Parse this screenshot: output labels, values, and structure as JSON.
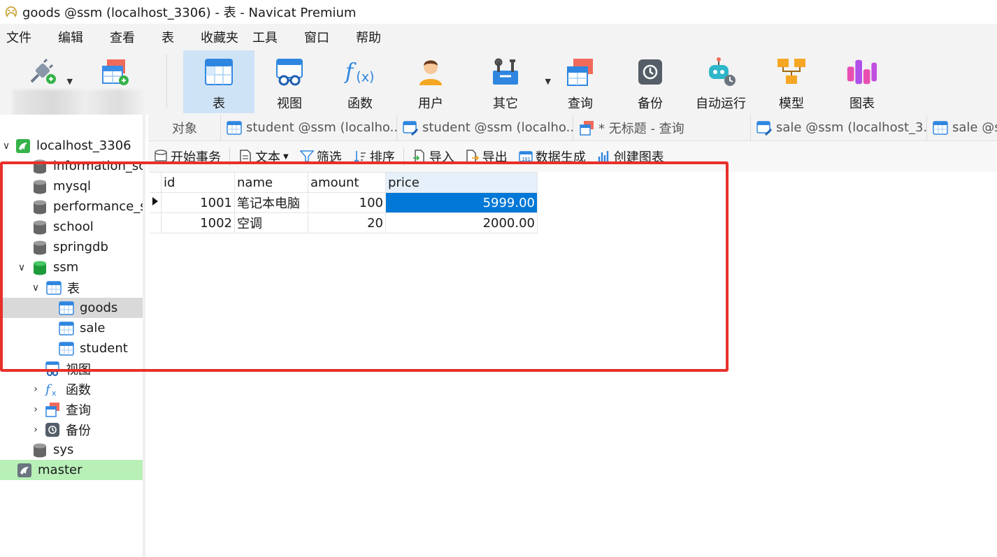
{
  "window": {
    "title": "goods @ssm (localhost_3306) - 表 - Navicat Premium"
  },
  "menu": [
    "文件",
    "编辑",
    "查看",
    "表",
    "收藏夹",
    "工具",
    "窗口",
    "帮助"
  ],
  "toolbar": {
    "items": [
      {
        "label": "表",
        "icon": "table-icon",
        "active": true
      },
      {
        "label": "视图",
        "icon": "view-icon"
      },
      {
        "label": "函数",
        "icon": "function-icon"
      },
      {
        "label": "用户",
        "icon": "user-icon"
      },
      {
        "label": "其它",
        "icon": "tools-icon",
        "has_dropdown": true
      },
      {
        "label": "查询",
        "icon": "query-icon"
      },
      {
        "label": "备份",
        "icon": "backup-icon"
      },
      {
        "label": "自动运行",
        "icon": "robot-icon"
      },
      {
        "label": "模型",
        "icon": "model-icon"
      },
      {
        "label": "图表",
        "icon": "chart-icon"
      }
    ]
  },
  "sidebar": {
    "connection": "localhost_3306",
    "databases": [
      "information_sch",
      "mysql",
      "performance_sc",
      "school",
      "springdb",
      "ssm"
    ],
    "ssm_children": {
      "tables_label": "表",
      "tables": [
        "goods",
        "sale",
        "student"
      ],
      "views_label": "视图",
      "functions_label": "函数",
      "queries_label": "查询",
      "backups_label": "备份"
    },
    "sys": "sys",
    "master": "master"
  },
  "tabs": [
    {
      "label": "对象"
    },
    {
      "label": "student @ssm (localho..."
    },
    {
      "label": "student @ssm (localho..."
    },
    {
      "label": "* 无标题 - 查询"
    },
    {
      "label": "sale @ssm (localhost_3..."
    },
    {
      "label": "sale @ss"
    }
  ],
  "object_toolbar": {
    "begin_transaction": "开始事务",
    "text": "文本",
    "filter": "筛选",
    "sort": "排序",
    "import": "导入",
    "export": "导出",
    "data_generation": "数据生成",
    "create_chart": "创建图表"
  },
  "grid": {
    "columns": [
      "id",
      "name",
      "amount",
      "price"
    ],
    "rows": [
      {
        "id": "1001",
        "name": "笔记本电脑",
        "amount": "100",
        "price": "5999.00"
      },
      {
        "id": "1002",
        "name": "空调",
        "amount": "20",
        "price": "2000.00"
      }
    ]
  },
  "colors": {
    "selection": "#0078d7",
    "highlight_box": "#e8302a",
    "active_tool": "#cfe3f7",
    "master_bg": "#b8f0b8"
  }
}
